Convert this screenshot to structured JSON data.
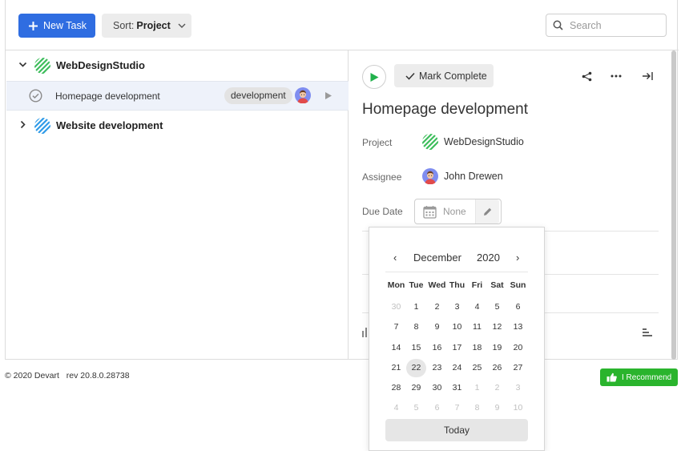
{
  "toolbar": {
    "new_task_label": "New Task",
    "sort_prefix": "Sort:",
    "sort_value": "Project",
    "search_placeholder": "Search"
  },
  "projects": [
    {
      "name": "WebDesignStudio",
      "icon_color": "#3dbd5b",
      "expanded": true,
      "tasks": [
        {
          "name": "Homepage development",
          "tag": "development",
          "selected": true
        }
      ]
    },
    {
      "name": "Website development",
      "icon_color": "#2f9be8",
      "expanded": false,
      "tasks": []
    }
  ],
  "details": {
    "mark_complete_label": "Mark Complete",
    "title": "Homepage development",
    "project_label": "Project",
    "project_value": "WebDesignStudio",
    "assignee_label": "Assignee",
    "assignee_value": "John Drewen",
    "due_label": "Due Date",
    "due_value": "None",
    "header_icons": [
      "share-icon",
      "more-icon",
      "close-panel-icon"
    ]
  },
  "calendar": {
    "prev": "‹",
    "next": "›",
    "month": "December",
    "year": "2020",
    "weekdays": [
      "Mon",
      "Tue",
      "Wed",
      "Thu",
      "Fri",
      "Sat",
      "Sun"
    ],
    "weeks": [
      [
        "30",
        "1",
        "2",
        "3",
        "4",
        "5",
        "6"
      ],
      [
        "7",
        "8",
        "9",
        "10",
        "11",
        "12",
        "13"
      ],
      [
        "14",
        "15",
        "16",
        "17",
        "18",
        "19",
        "20"
      ],
      [
        "21",
        "22",
        "23",
        "24",
        "25",
        "26",
        "27"
      ],
      [
        "28",
        "29",
        "30",
        "31",
        "1",
        "2",
        "3"
      ],
      [
        "4",
        "5",
        "6",
        "7",
        "8",
        "9",
        "10"
      ]
    ],
    "selected_day": "22",
    "today_label": "Today"
  },
  "footer": {
    "copyright": "© 2020 Devart",
    "revision": "rev 20.8.0.28738",
    "recommend_label": "I Recommend"
  },
  "colors": {
    "accent": "#2f6de1",
    "play_green": "#22b14c",
    "recommend_green": "#2ab42d"
  }
}
